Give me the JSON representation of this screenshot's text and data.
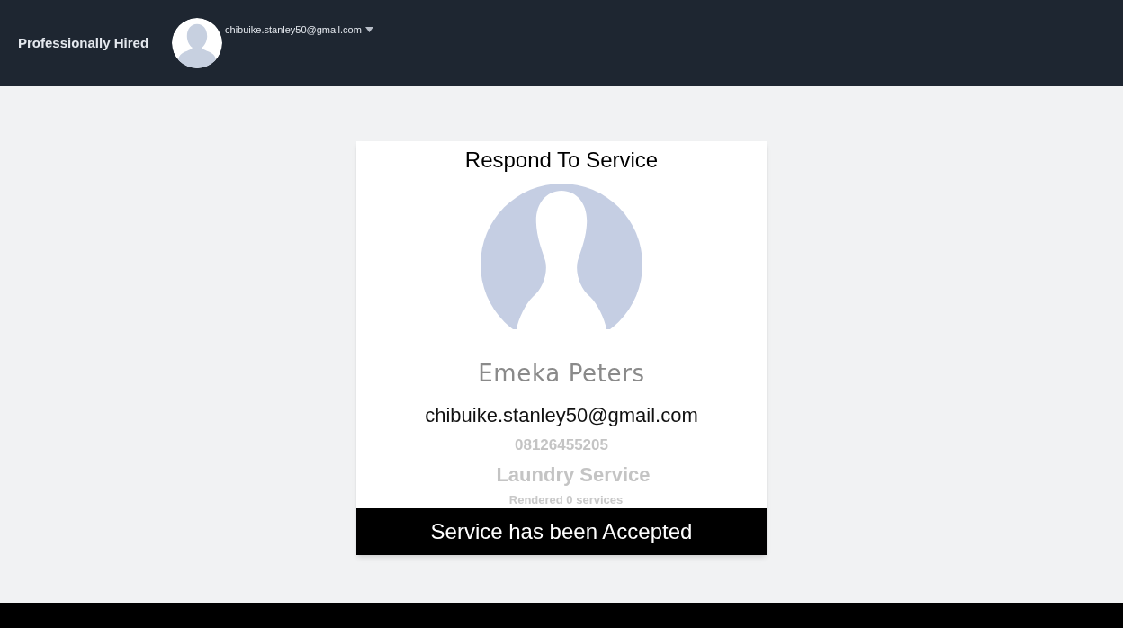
{
  "navbar": {
    "brand": "Professionally Hired",
    "user_email": "chibuike.stanley50@gmail.com"
  },
  "card": {
    "title": "Respond To Service",
    "name": "Emeka Peters",
    "email": "chibuike.stanley50@gmail.com",
    "phone": "08126455205",
    "service": "Laundry Service",
    "rendered": "Rendered 0 services",
    "status": "Service has been Accepted"
  }
}
